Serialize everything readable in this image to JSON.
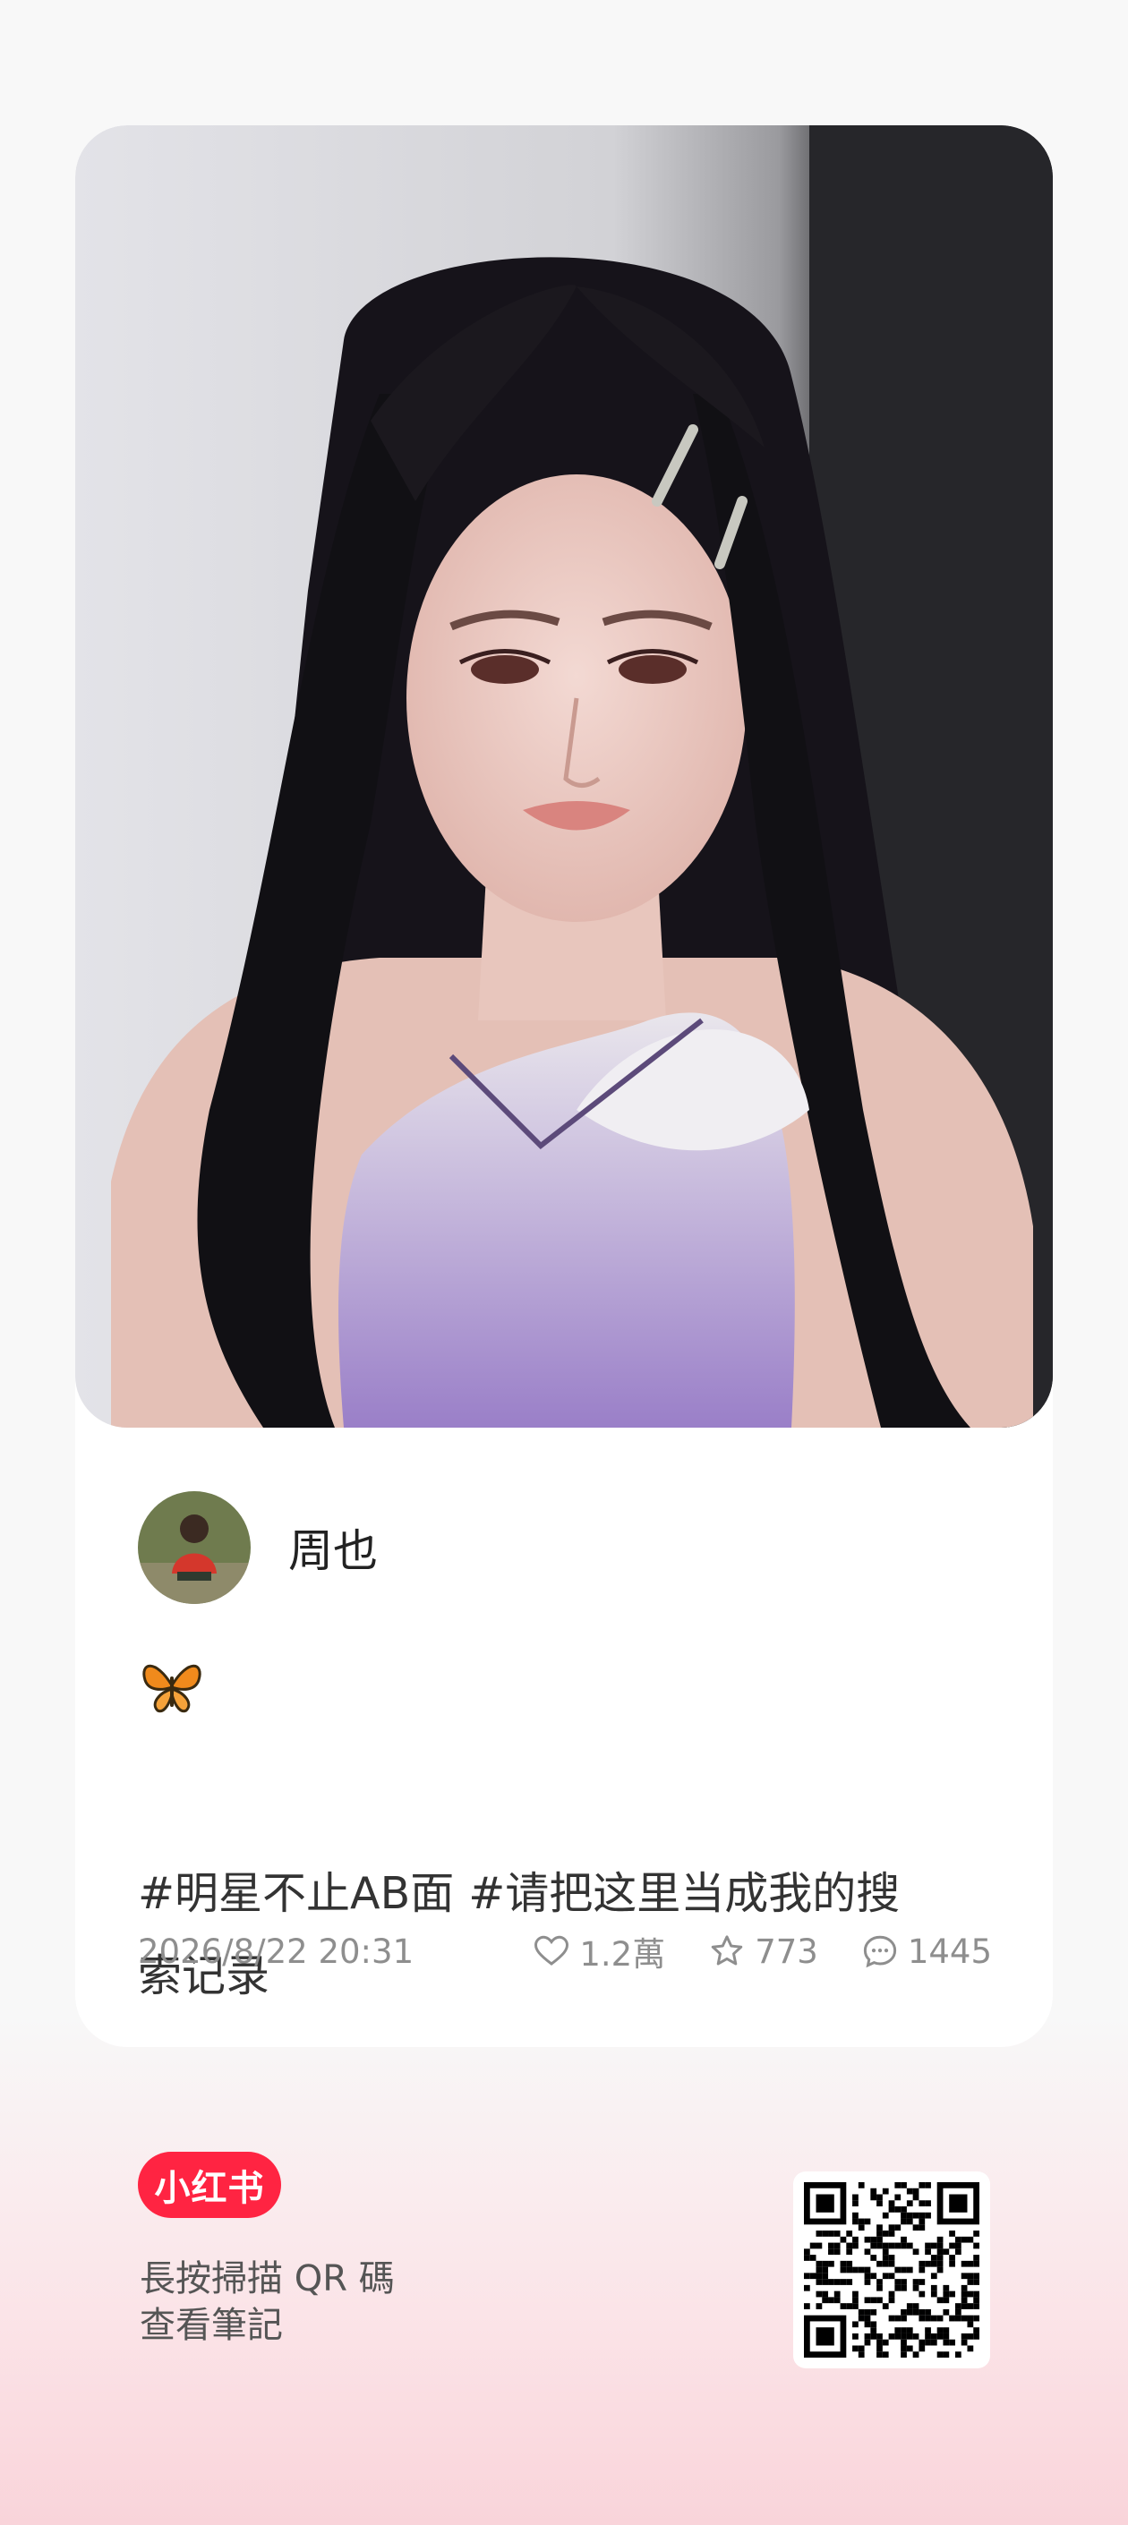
{
  "post": {
    "author_name": "周也",
    "emoji": "🦋",
    "hashtag_1": "#明星不止AB面",
    "hashtag_2": "#请把这里当成我的搜",
    "content_line_2": "索记录",
    "date": "2026/8/22 20:31",
    "likes": "1.2萬",
    "favorites": "773",
    "comments": "1445"
  },
  "footer": {
    "brand": "小红书",
    "scan_line_1": "長按掃描 QR 碼",
    "scan_line_2": "查看筆記"
  },
  "icons": {
    "like": "heart-icon",
    "favorite": "star-icon",
    "comment": "comment-bubble-icon"
  },
  "colors": {
    "brand": "#ff2442",
    "meta_text": "#8e8e8e"
  }
}
